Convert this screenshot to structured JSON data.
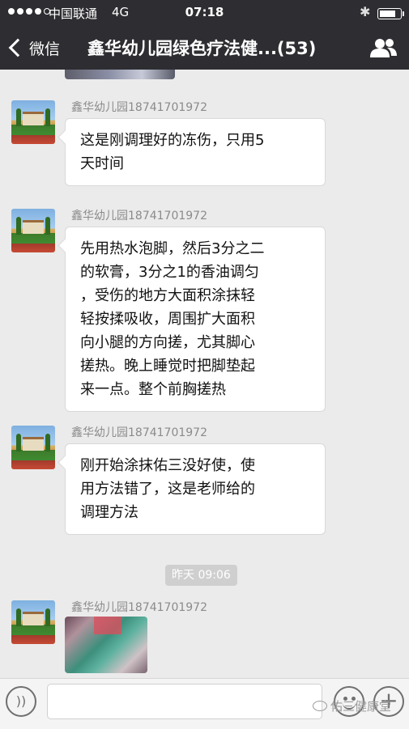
{
  "status_bar": {
    "carrier": "中国联通",
    "network": "4G",
    "time": "07:18",
    "signal_strength": 4,
    "battery_level": 0.85
  },
  "nav": {
    "back_label": "微信",
    "title": "鑫华幼儿园绿色疗法健...(53)",
    "group_icon": "group-icon"
  },
  "messages": [
    {
      "sender": "鑫华幼儿园18741701972",
      "lines": [
        "这是刚调理好的冻伤，只用5",
        "天时间"
      ]
    },
    {
      "sender": "鑫华幼儿园18741701972",
      "lines": [
        "先用热水泡脚，然后3分之二",
        "的软膏，3分之1的香油调匀",
        "，受伤的地方大面积涂抹轻",
        "轻按揉吸收，周围扩大面积",
        "向小腿的方向搓，尤其脚心",
        "搓热。晚上睡觉时把脚垫起",
        "来一点。整个前胸搓热"
      ]
    },
    {
      "sender": "鑫华幼儿园18741701972",
      "lines": [
        "刚开始涂抹佑三没好使，使",
        "用方法错了，这是老师给的",
        "调理方法"
      ]
    },
    {
      "sender": "鑫华幼儿园18741701972",
      "type": "image"
    }
  ],
  "time_separator": "昨天 09:06",
  "input": {
    "value": "",
    "voice_icon": "voice-icon",
    "emoji_icon": "emoji-icon",
    "plus_icon": "plus-icon"
  },
  "watermark": "佑三健康堂"
}
